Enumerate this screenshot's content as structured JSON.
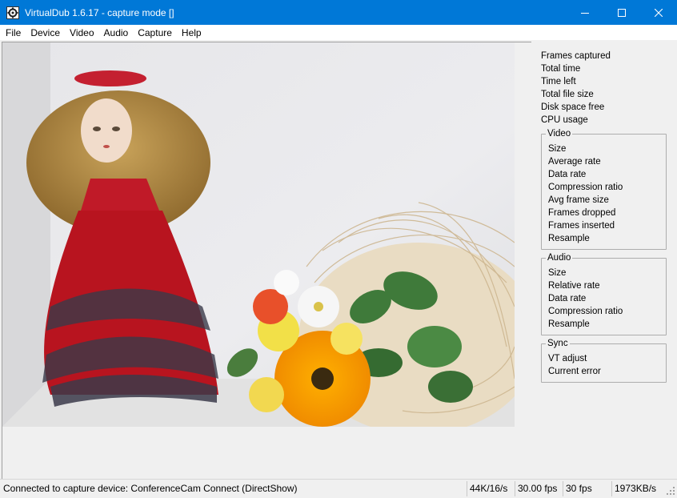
{
  "window": {
    "title": "VirtualDub 1.6.17 - capture mode []"
  },
  "menu": [
    "File",
    "Device",
    "Video",
    "Audio",
    "Capture",
    "Help"
  ],
  "info": {
    "top": [
      "Frames captured",
      "Total time",
      "Time left",
      "Total file size",
      "Disk space free",
      "CPU usage"
    ],
    "video": {
      "title": "Video",
      "lines": [
        "Size",
        "Average rate",
        "Data rate",
        "Compression ratio",
        "Avg frame size",
        "Frames dropped",
        "Frames inserted",
        "Resample"
      ]
    },
    "audio": {
      "title": "Audio",
      "lines": [
        "Size",
        "Relative rate",
        "Data rate",
        "Compression ratio",
        "Resample"
      ]
    },
    "sync": {
      "title": "Sync",
      "lines": [
        "VT adjust",
        "Current error"
      ]
    }
  },
  "status": {
    "message": "Connected to capture device: ConferenceCam Connect (DirectShow)",
    "audio_format": "44K/16/s",
    "fps": "30.00 fps",
    "fps_actual": "30 fps",
    "rate": "1973KB/s"
  },
  "icons": {
    "app": "virtualdub-gear-icon",
    "minimize": "minimize-icon",
    "maximize": "maximize-icon",
    "close": "close-icon"
  },
  "colors": {
    "titlebar": "#0078d7",
    "background": "#f0f0f0"
  }
}
